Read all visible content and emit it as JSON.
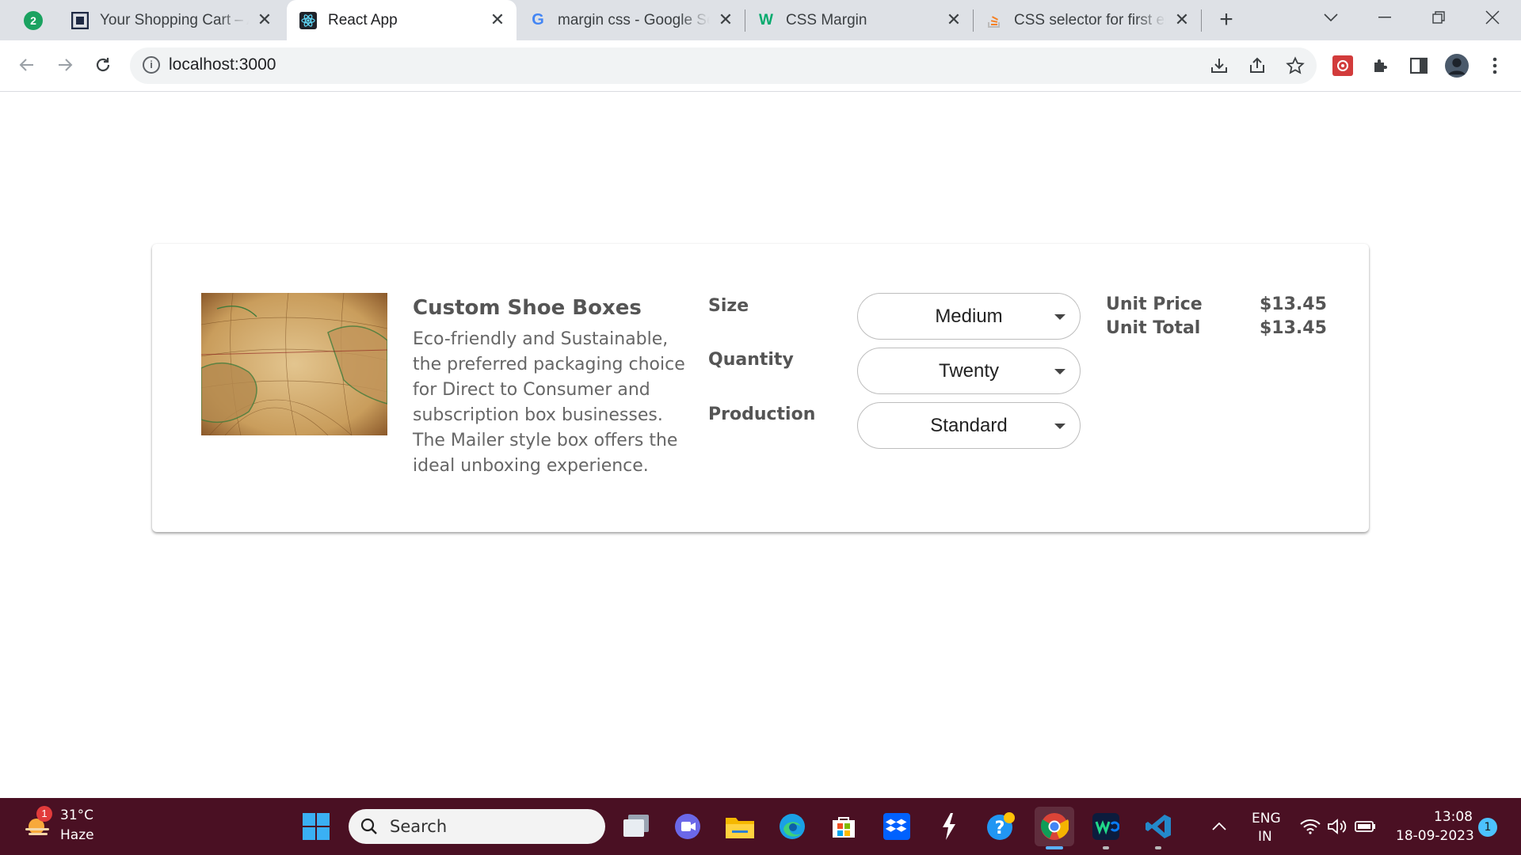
{
  "browser": {
    "profile_badge": "2",
    "tabs": [
      {
        "title": "Your Shopping Cart – Ar",
        "active": false
      },
      {
        "title": "React App",
        "active": true
      },
      {
        "title": "margin css - Google Sea",
        "active": false
      },
      {
        "title": "CSS Margin",
        "active": false
      },
      {
        "title": "CSS selector for first ele",
        "active": false
      }
    ],
    "url": "localhost:3000"
  },
  "product": {
    "title": "Custom Shoe Boxes",
    "description": "Eco-friendly and Sustainable, the preferred packaging choice for Direct to Consumer and subscription box businesses. The Mailer style box offers the ideal unboxing experience.",
    "options": [
      {
        "label": "Size",
        "value": "Medium"
      },
      {
        "label": "Quantity",
        "value": "Twenty"
      },
      {
        "label": "Production",
        "value": "Standard"
      }
    ],
    "unit_price_label": "Unit Price",
    "unit_price": "$13.45",
    "unit_total_label": "Unit Total",
    "unit_total": "$13.45"
  },
  "taskbar": {
    "weather_temp": "31°C",
    "weather_desc": "Haze",
    "weather_badge": "1",
    "search_placeholder": "Search",
    "lang": "ENG",
    "region": "IN",
    "time": "13:08",
    "date": "18-09-2023",
    "notif_count": "1"
  },
  "colors": {
    "taskbar": "#4a1023",
    "tabstrip": "#dee1e6",
    "text_muted": "#555555"
  }
}
